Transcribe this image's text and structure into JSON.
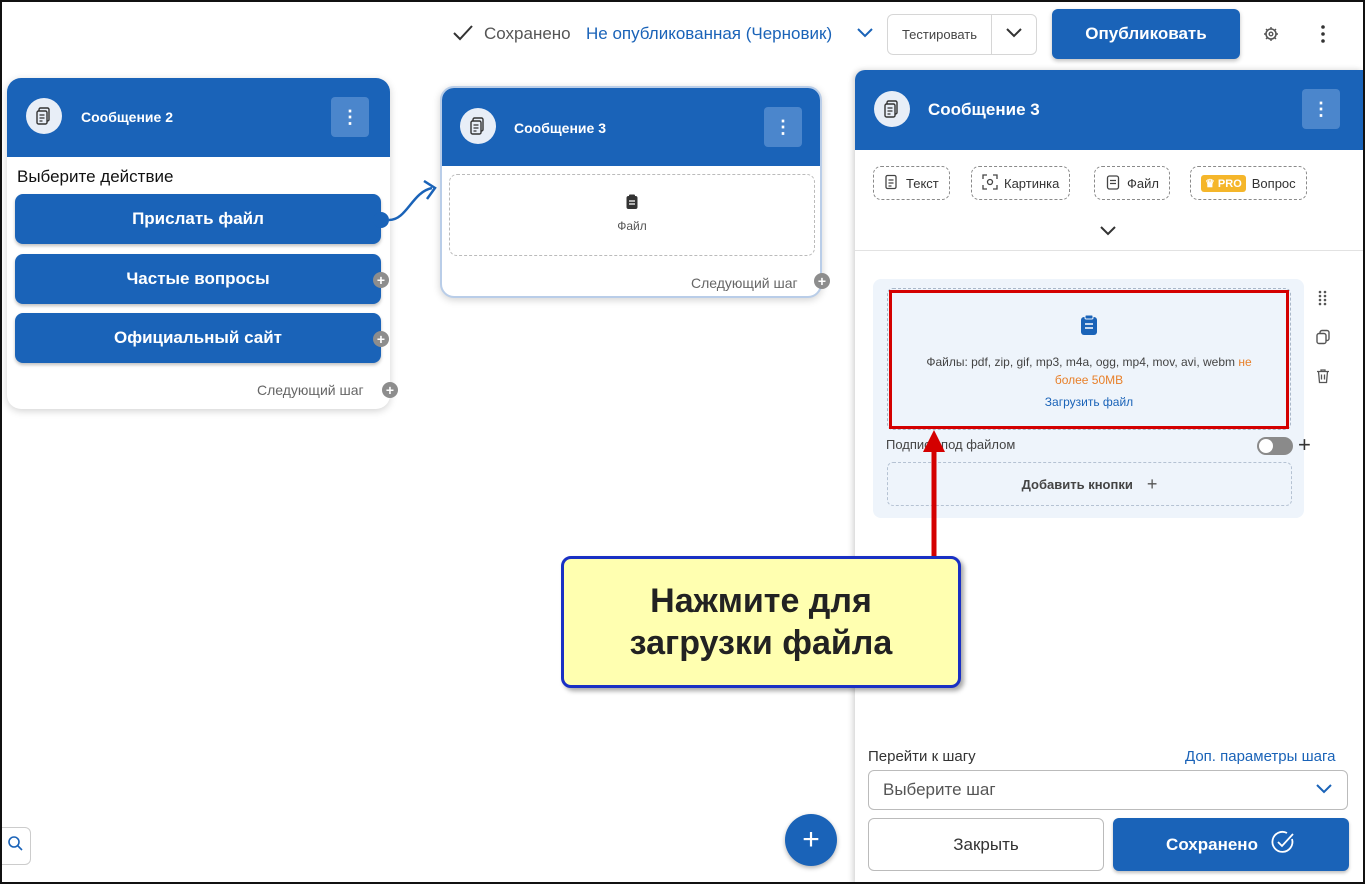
{
  "topbar": {
    "saved_label": "Сохранено",
    "status_label": "Не опубликованная (Черновик)",
    "test_label": "Тестировать",
    "publish_label": "Опубликовать"
  },
  "node2": {
    "title": "Сообщение 2",
    "prompt": "Выберите действие",
    "buttons": [
      "Прислать файл",
      "Частые вопросы",
      "Официальный сайт"
    ],
    "next_step": "Следующий шаг"
  },
  "node3": {
    "title": "Сообщение 3",
    "file_label": "Файл",
    "next_step": "Следующий шаг"
  },
  "panel": {
    "title": "Сообщение 3",
    "chips": {
      "text": "Текст",
      "image": "Картинка",
      "file": "Файл",
      "pro": "PRO",
      "question": "Вопрос"
    },
    "file_block": {
      "formats": "Файлы: pdf, zip, gif, mp3, m4a, ogg, mp4, mov, avi, webm",
      "limit": "не более 50MB",
      "upload_link": "Загрузить файл",
      "caption_label": "Подпись под файлом",
      "caption_toggle_on": false,
      "add_buttons": "Добавить кнопки"
    },
    "goto_label": "Перейти к шагу",
    "step_params_link": "Доп. параметры шага",
    "select_placeholder": "Выберите шаг",
    "close_label": "Закрыть",
    "saved_label": "Сохранено"
  },
  "callout": {
    "text": "Нажмите для загрузки файла"
  },
  "colors": {
    "primary": "#1a63b8",
    "highlight": "#d40000",
    "callout_bg": "#ffffb0",
    "limit_text": "#e8802a"
  }
}
